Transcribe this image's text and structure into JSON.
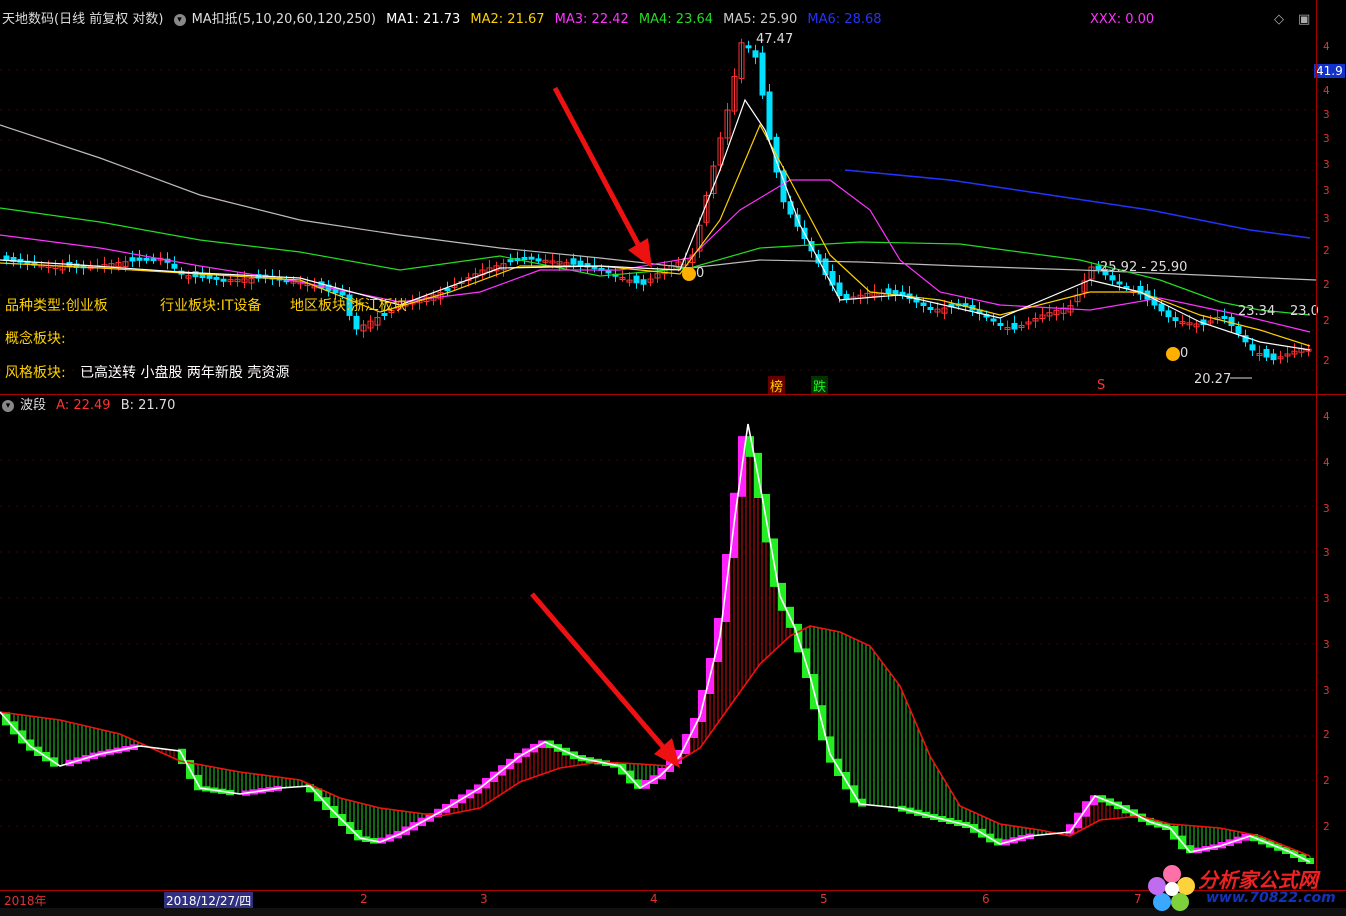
{
  "header": {
    "title": "天地数码(日线 前复权 对数)",
    "ma_label": "MA扣抵(5,10,20,60,120,250)",
    "ma": [
      {
        "label": "MA1: 21.73",
        "color": "#ffffff"
      },
      {
        "label": "MA2: 21.67",
        "color": "#ffd000"
      },
      {
        "label": "MA3: 22.42",
        "color": "#ff33ff"
      },
      {
        "label": "MA4: 23.64",
        "color": "#22dd22"
      },
      {
        "label": "MA5: 25.90",
        "color": "#cccccc"
      },
      {
        "label": "MA6: 28.68",
        "color": "#2233ff"
      }
    ],
    "xxx": "XXX: 0.00",
    "right_price": "41.9"
  },
  "tags": {
    "variety": "品种类型:创业板",
    "industry": "行业板块:IT设备",
    "region": "地区板块:浙江板块",
    "concept": "概念板块:",
    "style_label": "风格板块:",
    "style_value": "已高送转 小盘股 两年新股 壳资源"
  },
  "annotations": {
    "high": "47.47",
    "pair": "25.92 - 25.90",
    "low": "20.27",
    "right_a": "23.34",
    "right_b": "23.0",
    "bang": "榜",
    "die": "跌",
    "s_mark": "S",
    "coin1": "0",
    "coin2": "0"
  },
  "indicator": {
    "name": "波段",
    "a": "A: 22.49",
    "b": "B: 21.70"
  },
  "dates": [
    "2018年",
    "2018/12/27/四",
    "2",
    "3",
    "4",
    "5",
    "6",
    "7"
  ],
  "logo": {
    "text": "分析家公式网",
    "url": "www.70822.com"
  },
  "colors": {
    "up": "#ff3333",
    "down": "#00e0ff",
    "bg": "#000000",
    "axis": "#aa0000"
  }
}
